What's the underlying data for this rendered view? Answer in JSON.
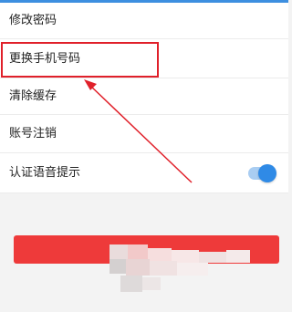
{
  "settings": {
    "items": [
      {
        "label": "修改密码"
      },
      {
        "label": "更换手机号码"
      },
      {
        "label": "清除缓存"
      },
      {
        "label": "账号注销"
      },
      {
        "label": "认证语音提示",
        "toggle_on": true
      }
    ]
  },
  "logout_button": {
    "label": "退出登录"
  },
  "colors": {
    "highlight": "#e0202a",
    "toggle_accent": "#2f8ae6",
    "logout": "#ee3a3a"
  }
}
